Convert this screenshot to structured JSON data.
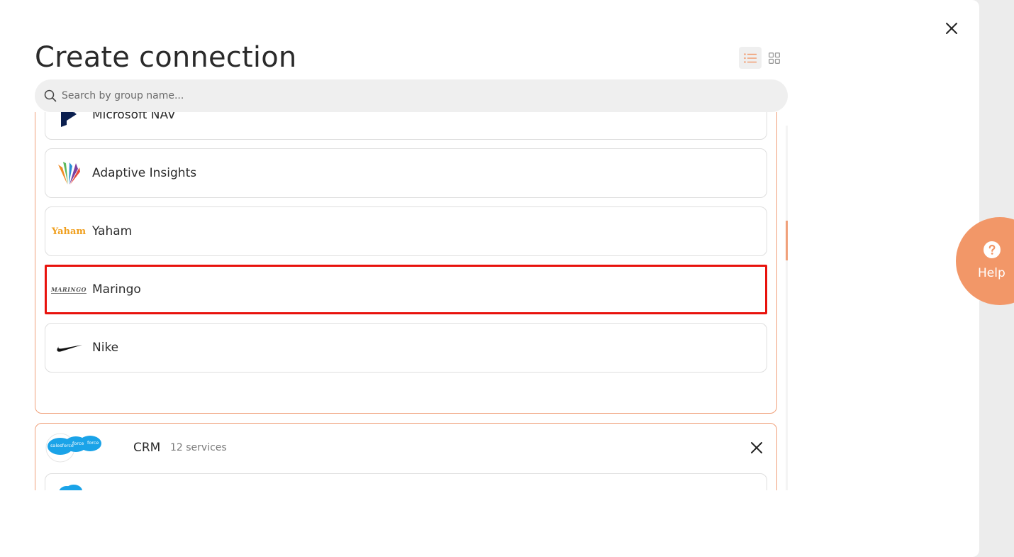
{
  "title": "Create connection",
  "search": {
    "placeholder": "Search by group name..."
  },
  "view_toggle": {
    "active": "list"
  },
  "group1": {
    "items": [
      {
        "label": "Microsoft NAV",
        "logo": "microsoft-dynamics-logo"
      },
      {
        "label": "Adaptive Insights",
        "logo": "adaptive-insights-logo"
      },
      {
        "label": "Yaham",
        "logo": "yaham-logo",
        "logo_text": "Yaham"
      },
      {
        "label": "Maringo",
        "logo": "maringo-logo",
        "logo_text": "MARINGO",
        "highlighted": true
      },
      {
        "label": "Nike",
        "logo": "nike-swoosh-logo"
      }
    ]
  },
  "group2": {
    "title": "CRM",
    "count": "12 services",
    "logo_text": "salesforce",
    "logo_text_short": "force"
  },
  "help": {
    "label": "Help"
  },
  "colors": {
    "accent": "#f29768",
    "border_accent": "#f0a07a",
    "highlight": "#e8120c"
  }
}
